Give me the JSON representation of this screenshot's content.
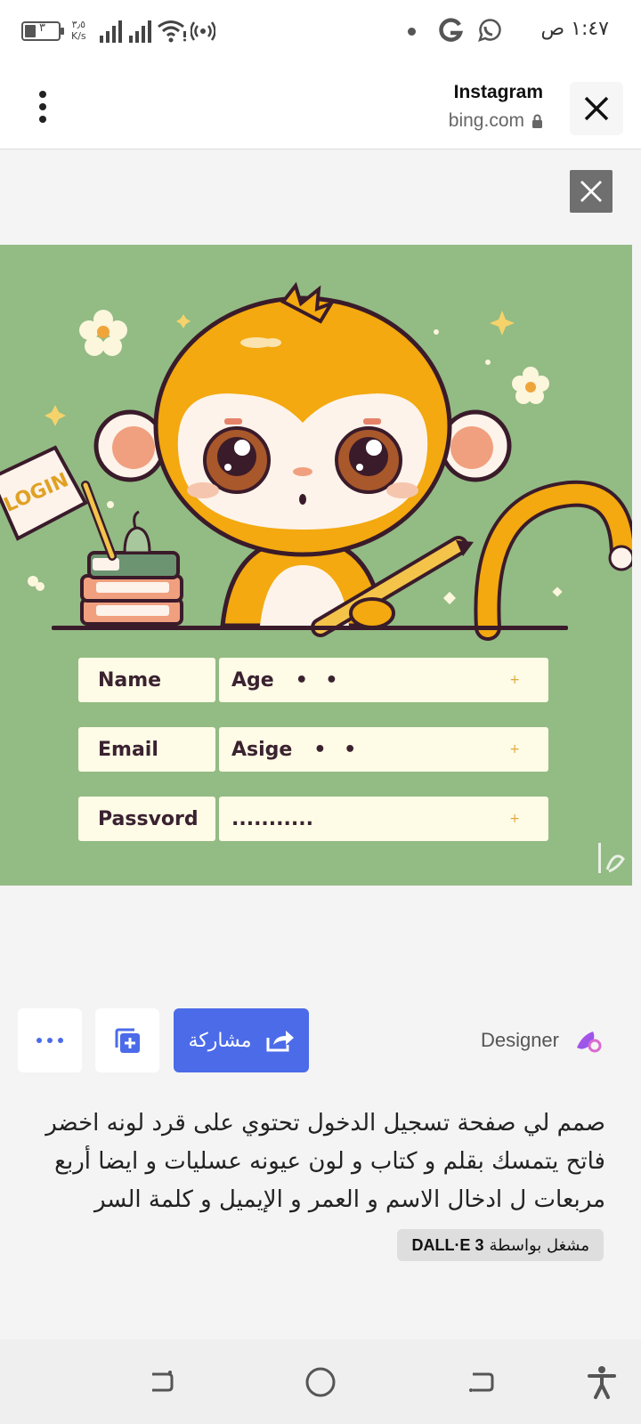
{
  "status_bar": {
    "time": "١:٤٧ ص",
    "battery": "٣",
    "net_speed_value": "٣٫٥",
    "net_speed_unit": "K/s"
  },
  "browser": {
    "title": "Instagram",
    "url": "bing.com"
  },
  "image": {
    "sign_text": "LOGIN",
    "fields": [
      {
        "label": "Name",
        "value": "Age",
        "dots": "• •"
      },
      {
        "label": "Email",
        "value": "Asige",
        "dots": "• •"
      },
      {
        "label": "Passvord",
        "value": "...........",
        "dots": ""
      }
    ],
    "plus": "+"
  },
  "actions": {
    "share_label": "مشاركة",
    "designer_label": "Designer"
  },
  "prompt": {
    "text": "صمم لي صفحة تسجيل الدخول تحتوي على قرد لونه اخضر فاتح يتمسك بقلم و كتاب و لون عيونه عسليات و ايضا أربع مربعات ل ادخال الاسم و العمر و الإيميل و كلمة السر"
  },
  "badge": {
    "prefix": "مشغل بواسطة",
    "model": "DALL·E 3"
  },
  "colors": {
    "accent": "#4b6be8",
    "image_bg": "#93bb84",
    "monkey": "#f3a90f"
  }
}
